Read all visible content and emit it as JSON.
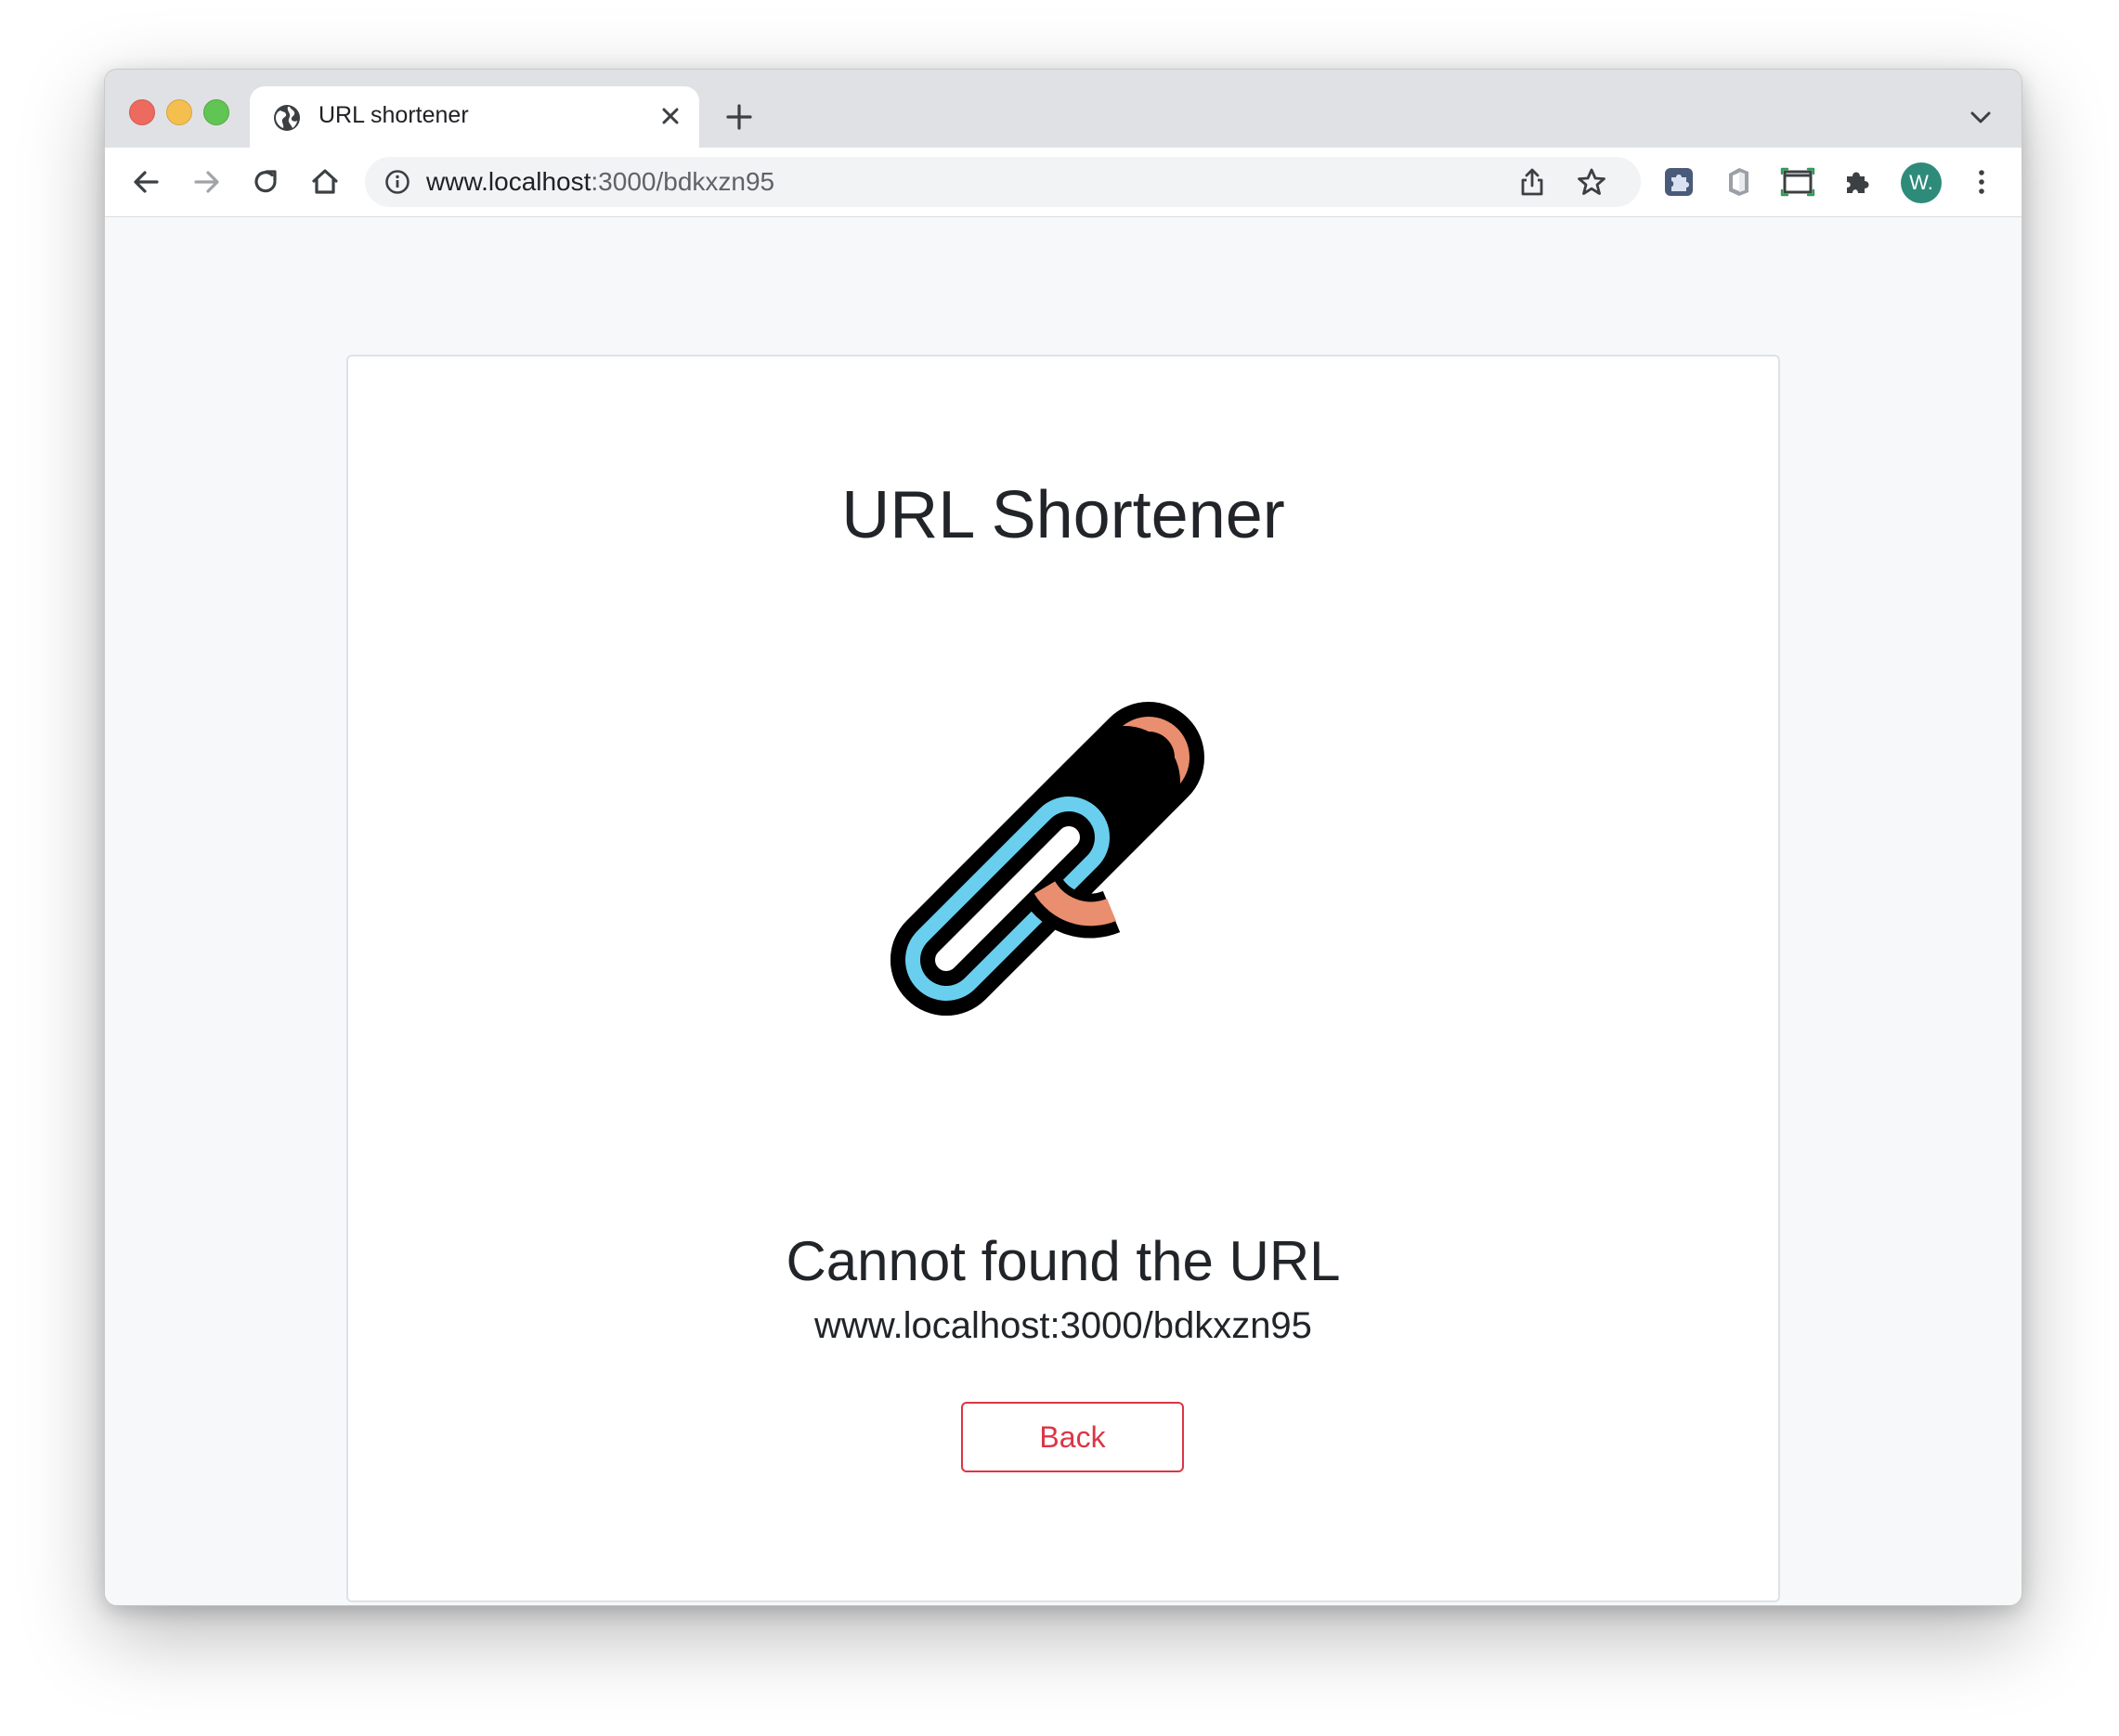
{
  "browser": {
    "tab": {
      "title": "URL shortener",
      "icon": "globe-icon"
    },
    "address_bar": {
      "host": "www.localhost",
      "path": ":3000/bdkxzn95"
    },
    "profile": {
      "initial": "W.",
      "color": "#2e8b7a"
    },
    "icons": {
      "back": "arrow-left-icon",
      "forward": "arrow-right-icon",
      "reload": "reload-icon",
      "home": "home-icon",
      "site_info": "info-icon",
      "share": "share-icon",
      "bookmark": "star-icon",
      "extension_1": "puzzle-square-icon",
      "extension_2": "office-icon",
      "extension_3": "screen-capture-icon",
      "extensions": "puzzle-icon",
      "menu": "kebab-menu-icon"
    }
  },
  "page": {
    "title": "URL Shortener",
    "illustration": "chain-link-icon",
    "error_title": "Cannot found the URL",
    "error_url": "www.localhost:3000/bdkxzn95",
    "back_label": "Back",
    "colors": {
      "link_orange": "#e98e6e",
      "link_blue": "#6acfee",
      "danger": "#dc3545"
    }
  }
}
